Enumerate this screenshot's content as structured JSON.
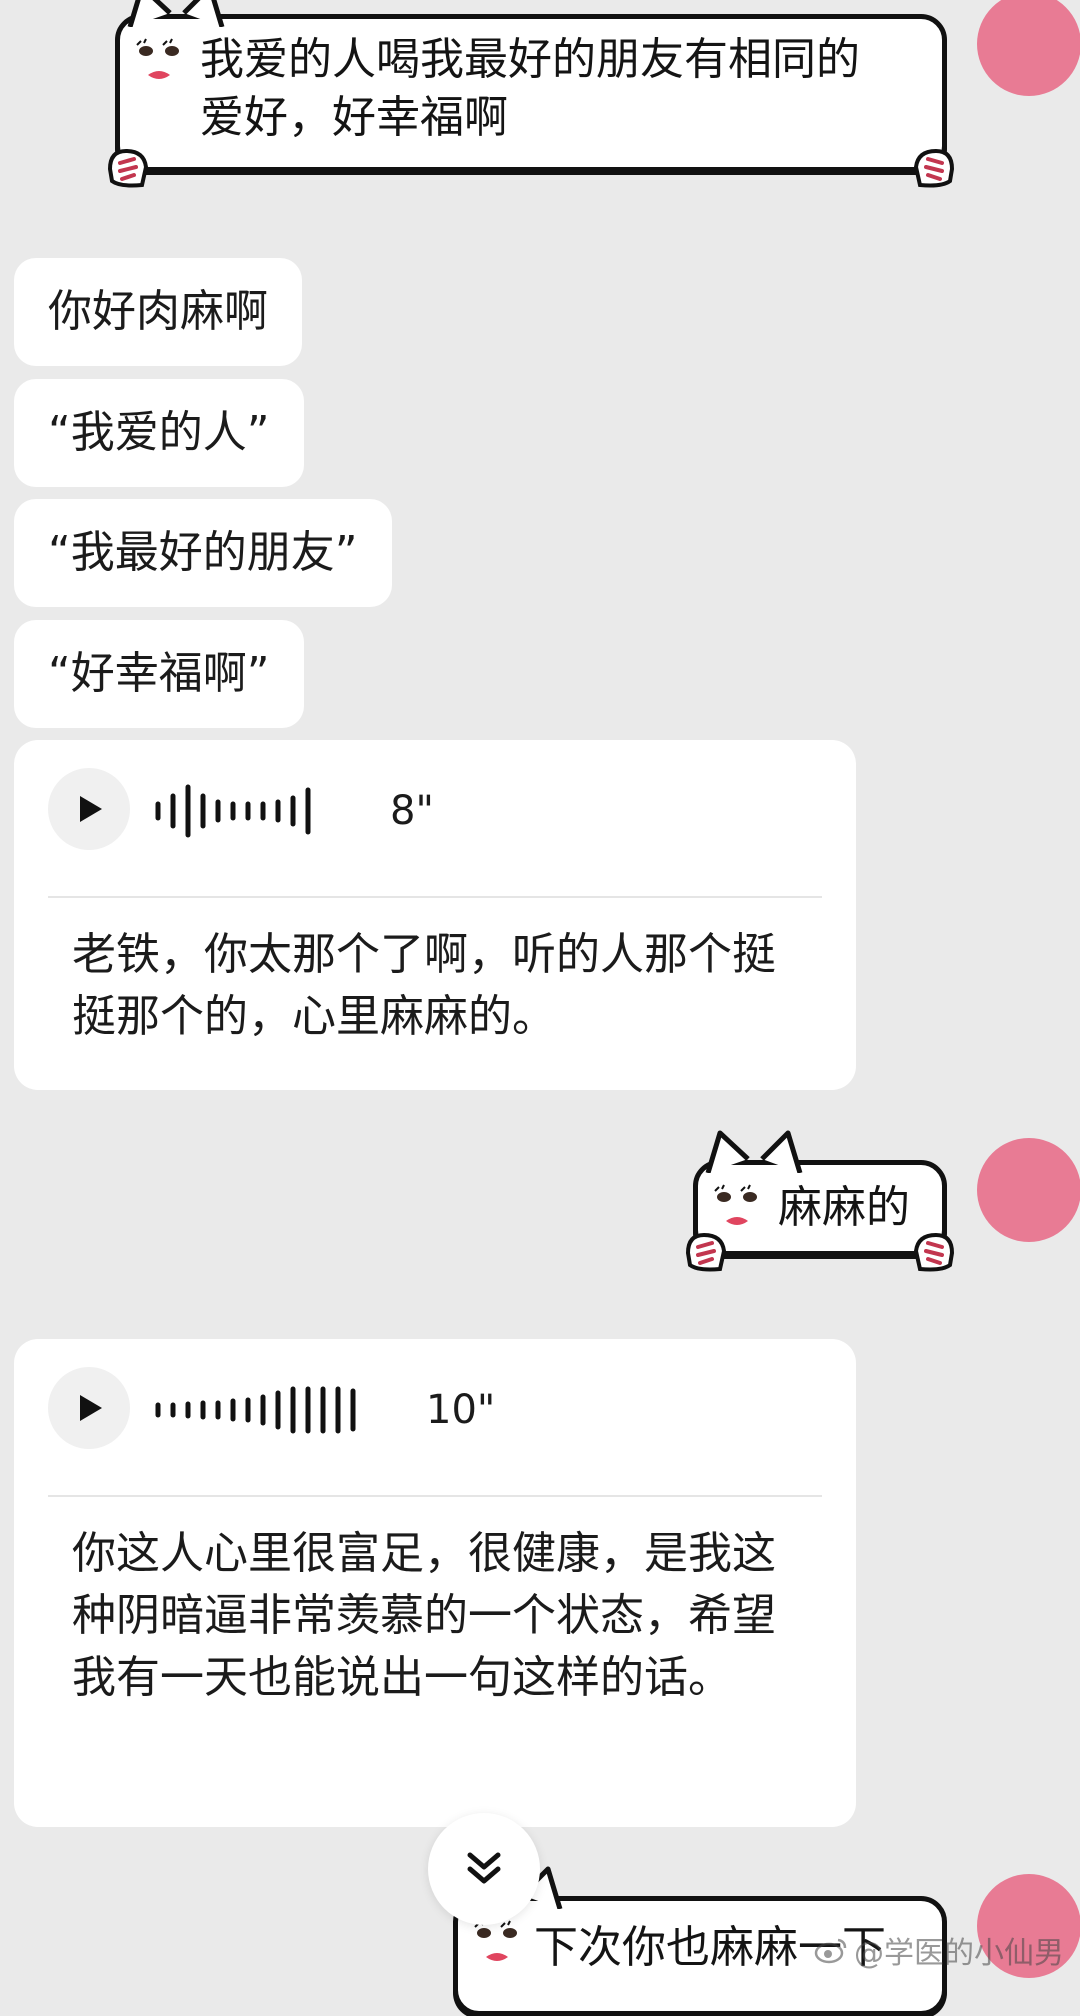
{
  "colors": {
    "background": "#eaeaea",
    "bubble": "#ffffff",
    "avatar": "#e87b94",
    "text": "#1b1b1b"
  },
  "messages": {
    "sticker_top": "我爱的人喝我最好的朋友有相同的\n爱好，好幸福啊",
    "reply_1": "你好肉麻啊",
    "reply_2": "“我爱的人”",
    "reply_3": "“我最好的朋友”",
    "reply_4": "“好幸福啊”",
    "voice_1": {
      "duration": "8\"",
      "transcript": "老铁，你太那个了啊，听的人那个挺挺那个的，心里麻麻的。"
    },
    "sticker_mid": "麻麻的",
    "voice_2": {
      "duration": "10\"",
      "transcript": "你这人心里很富足，很健康，是我这种阴暗逼非常羡慕的一个状态，希望我有一天也能说出一句这样的话。"
    },
    "sticker_bottom": "下次你也麻麻一下"
  },
  "icons": {
    "play": "play-icon",
    "waveform": "waveform-icon",
    "scroll_down": "double-chevron-down-icon",
    "weibo": "weibo-logo-icon"
  },
  "watermark": "@学医的小仙男"
}
